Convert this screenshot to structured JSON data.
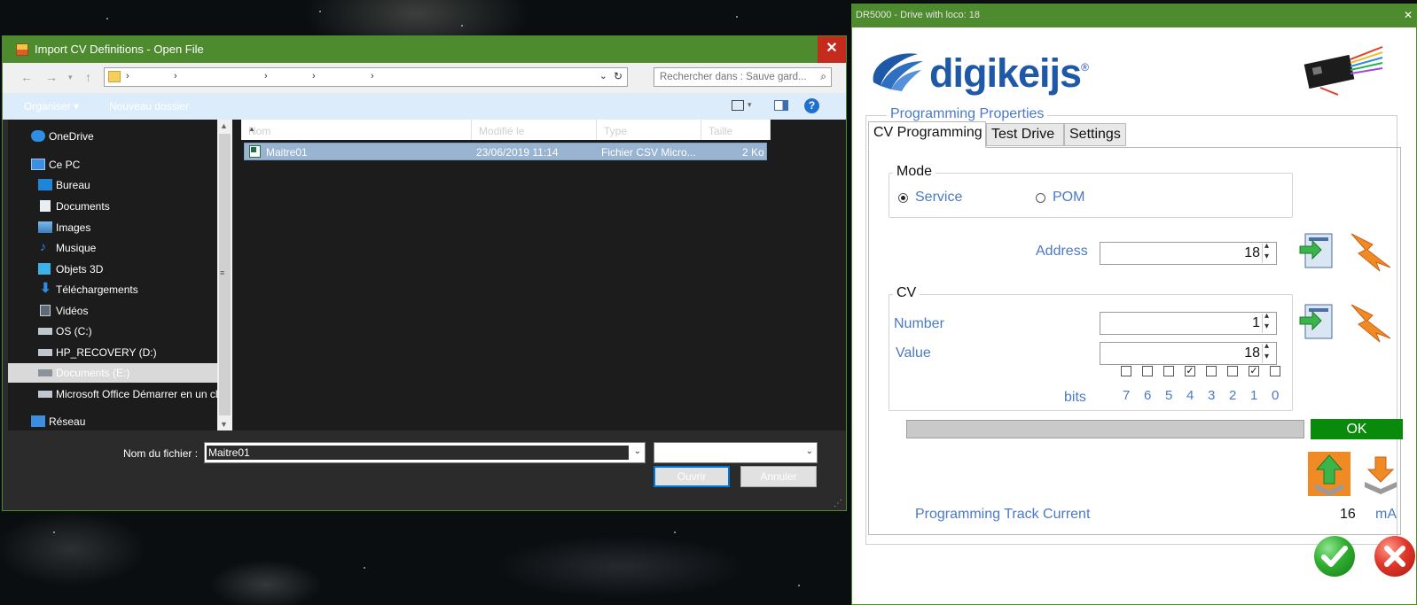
{
  "file_dialog": {
    "title": "Import CV Definitions - Open File",
    "close_glyph": "✕",
    "search_placeholder": "Rechercher dans : Sauve gard...",
    "commands": {
      "organize": "Organiser ▾",
      "new_folder": "Nouveau dossier"
    },
    "help_glyph": "?",
    "nav_items": [
      {
        "label": "OneDrive",
        "icon": "cloud-icon"
      },
      {
        "label": "Ce PC",
        "icon": "pc-icon"
      },
      {
        "label": "Bureau",
        "icon": "desktop-icon"
      },
      {
        "label": "Documents",
        "icon": "documents-icon"
      },
      {
        "label": "Images",
        "icon": "images-icon"
      },
      {
        "label": "Musique",
        "icon": "music-icon"
      },
      {
        "label": "Objets 3D",
        "icon": "cube-icon"
      },
      {
        "label": "Téléchargements",
        "icon": "download-icon"
      },
      {
        "label": "Vidéos",
        "icon": "video-icon"
      },
      {
        "label": "OS (C:)",
        "icon": "drive-icon"
      },
      {
        "label": "HP_RECOVERY (D:)",
        "icon": "drive-icon"
      },
      {
        "label": "Documents (E:)",
        "icon": "drive-icon"
      },
      {
        "label": "Microsoft Office Démarrer en un cl",
        "icon": "drive-icon"
      },
      {
        "label": "Réseau",
        "icon": "network-icon"
      }
    ],
    "columns": [
      "Nom",
      "Modifié le",
      "Type",
      "Taille"
    ],
    "files": [
      {
        "name": "Maitre01",
        "modified": "23/06/2019 11:14",
        "type": "Fichier CSV Micro...",
        "size": "2 Ko"
      }
    ],
    "filename_label": "Nom du fichier :",
    "filename_value": "Maitre01",
    "filetype_value": "",
    "open_button": "Ouvrir",
    "cancel_button": "Annuler"
  },
  "dr5000": {
    "title": "DR5000 - Drive with loco: 18",
    "close_glyph": "✕",
    "brand": "digikeijs",
    "brand_mark": "®",
    "section_title": "Programming Properties",
    "tabs": [
      "CV Programming",
      "Test Drive",
      "Settings"
    ],
    "active_tab": 0,
    "mode": {
      "legend": "Mode",
      "options": [
        {
          "label": "Service",
          "selected": true
        },
        {
          "label": "POM",
          "selected": false
        }
      ]
    },
    "address": {
      "label": "Address",
      "value": "18"
    },
    "cv": {
      "legend": "CV",
      "number_label": "Number",
      "number_value": "1",
      "value_label": "Value",
      "value_value": "18",
      "bits_label": "bits",
      "bits": [
        {
          "n": "7",
          "checked": false
        },
        {
          "n": "6",
          "checked": false
        },
        {
          "n": "5",
          "checked": false
        },
        {
          "n": "4",
          "checked": true
        },
        {
          "n": "3",
          "checked": false
        },
        {
          "n": "2",
          "checked": false
        },
        {
          "n": "1",
          "checked": true
        },
        {
          "n": "0",
          "checked": false
        }
      ]
    },
    "status_text": "OK",
    "progress": 0,
    "track_current": {
      "label": "Programming Track Current",
      "value": "16",
      "unit": "mA"
    },
    "colors": {
      "accent": "#4a79c8",
      "title_green": "#4e8a2e",
      "ok_green": "#0a8a0a",
      "orange": "#f08a24"
    }
  }
}
